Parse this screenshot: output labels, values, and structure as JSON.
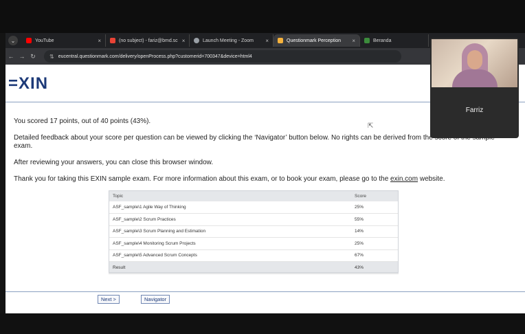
{
  "browser": {
    "tabs": [
      {
        "label": "YouTube",
        "color": "#ff0000",
        "active": false
      },
      {
        "label": "(no subject) - fariz@bmd.sc",
        "color": "#e94335",
        "active": false
      },
      {
        "label": "Launch Meeting - Zoom",
        "color": "#9aa0a6",
        "active": false
      },
      {
        "label": "Questionmark Perception",
        "color": "#f6b23c",
        "active": true
      },
      {
        "label": "Beranda",
        "color": "#3c8c3c",
        "active": false
      }
    ],
    "url": "eucentral.questionmark.com/delivery/openProcess.php?customerid=700347&device=html4"
  },
  "page": {
    "logo": "=XIN",
    "score_summary": "You scored 17 points, out of 40 points (43%).",
    "feedback": "Detailed feedback about your score per question can be viewed by clicking the ‘Navigator’ button below. No rights can be derived from the score of the sample exam.",
    "review": "After reviewing your answers, you can close this browser window.",
    "thanks_prefix": "Thank you for taking this EXIN sample exam. For more information about this exam, or to book your exam, please go to the ",
    "thanks_link": "exin.com",
    "thanks_suffix": " website."
  },
  "table": {
    "headers": {
      "topic": "Topic",
      "score": "Score"
    },
    "rows": [
      {
        "topic": "ASF_sample\\1 Agile Way of Thinking",
        "score": "25%"
      },
      {
        "topic": "ASF_sample\\2 Scrum Practices",
        "score": "55%"
      },
      {
        "topic": "ASF_sample\\3 Scrum Planning and Estimation",
        "score": "14%"
      },
      {
        "topic": "ASF_sample\\4 Monitoring Scrum Projects",
        "score": "25%"
      },
      {
        "topic": "ASF_sample\\5 Advanced Scrum Concepts",
        "score": "67%"
      }
    ],
    "result": {
      "topic": "Result",
      "score": "43%"
    }
  },
  "buttons": {
    "next": "Next >",
    "navigator": "Navigator"
  },
  "video": {
    "name": "Farriz"
  }
}
